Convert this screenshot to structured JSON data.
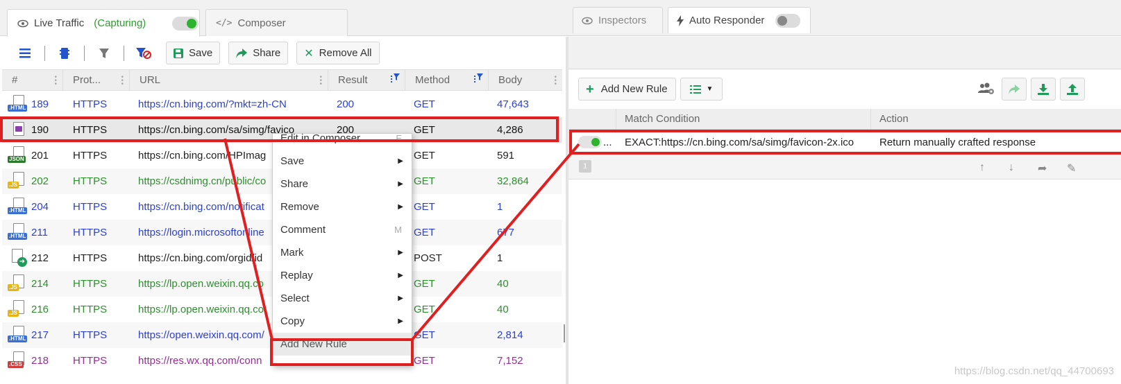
{
  "top_tabs": {
    "live_traffic": {
      "label": "Live Traffic",
      "status": "(Capturing)",
      "toggle": "on"
    },
    "composer": {
      "label": "Composer"
    }
  },
  "toolbar": {
    "save_label": "Save",
    "share_label": "Share",
    "remove_all_label": "Remove All"
  },
  "grid": {
    "headers": [
      "#",
      "Prot...",
      "URL",
      "Result",
      "Method",
      "Body"
    ],
    "rows": [
      {
        "icon": "HTML",
        "num": "189",
        "proto": "HTTPS",
        "url": "https://cn.bing.com/?mkt=zh-CN",
        "result": "200",
        "method": "GET",
        "body": "47,643",
        "color": "blue"
      },
      {
        "icon": "IMG",
        "num": "190",
        "proto": "HTTPS",
        "url": "https://cn.bing.com/sa/simg/favico",
        "result": "200",
        "method": "GET",
        "body": "4,286",
        "color": "black"
      },
      {
        "icon": "JSON",
        "num": "201",
        "proto": "HTTPS",
        "url": "https://cn.bing.com/HPImag",
        "result": "",
        "method": "GET",
        "body": "591",
        "color": "black"
      },
      {
        "icon": "JS",
        "num": "202",
        "proto": "HTTPS",
        "url": "https://csdnimg.cn/public/co",
        "result": "",
        "method": "GET",
        "body": "32,864",
        "color": "green"
      },
      {
        "icon": "HTML",
        "num": "204",
        "proto": "HTTPS",
        "url": "https://cn.bing.com/notificat",
        "result": "",
        "method": "GET",
        "body": "1",
        "color": "blue"
      },
      {
        "icon": "HTML",
        "num": "211",
        "proto": "HTTPS",
        "url": "https://login.microsoftonline",
        "result": "",
        "method": "GET",
        "body": "677",
        "color": "blue"
      },
      {
        "icon": "POST",
        "num": "212",
        "proto": "HTTPS",
        "url": "https://cn.bing.com/orgid/id",
        "result": "",
        "method": "POST",
        "body": "1",
        "color": "black"
      },
      {
        "icon": "JS",
        "num": "214",
        "proto": "HTTPS",
        "url": "https://lp.open.weixin.qq.co",
        "result": "",
        "method": "GET",
        "body": "40",
        "color": "green"
      },
      {
        "icon": "JS",
        "num": "216",
        "proto": "HTTPS",
        "url": "https://lp.open.weixin.qq.co",
        "result": "",
        "method": "GET",
        "body": "40",
        "color": "green"
      },
      {
        "icon": "HTML",
        "num": "217",
        "proto": "HTTPS",
        "url": "https://open.weixin.qq.com/",
        "result": "",
        "method": "GET",
        "body": "2,814",
        "color": "blue"
      },
      {
        "icon": "CSS",
        "num": "218",
        "proto": "HTTPS",
        "url": "https://res.wx.qq.com/conn",
        "result": "",
        "method": "GET",
        "body": "7,152",
        "color": "purple"
      }
    ]
  },
  "context_menu": {
    "items": [
      {
        "label": "Edit in Composer",
        "shortcut": "E",
        "submenu": false
      },
      {
        "label": "Save",
        "shortcut": "",
        "submenu": true
      },
      {
        "label": "Share",
        "shortcut": "",
        "submenu": true
      },
      {
        "label": "Remove",
        "shortcut": "",
        "submenu": true
      },
      {
        "label": "Comment",
        "shortcut": "M",
        "submenu": false
      },
      {
        "label": "Mark",
        "shortcut": "",
        "submenu": true
      },
      {
        "label": "Replay",
        "shortcut": "",
        "submenu": true
      },
      {
        "label": "Select",
        "shortcut": "",
        "submenu": true
      },
      {
        "label": "Copy",
        "shortcut": "",
        "submenu": true
      },
      {
        "label": "Add New Rule",
        "shortcut": "",
        "submenu": false,
        "highlighted": true
      }
    ]
  },
  "right_panel": {
    "tabs": {
      "inspectors": "Inspectors",
      "auto_responder": "Auto Responder",
      "auto_responder_toggle": "off"
    },
    "add_new_rule_label": "Add New Rule",
    "headers": [
      "Match Condition",
      "Action"
    ],
    "rules": [
      {
        "enabled": true,
        "toggle_text": "...",
        "match": "EXACT:https://cn.bing.com/sa/simg/favicon-2x.ico",
        "action": "Return manually crafted response"
      }
    ],
    "rule_count": "1"
  },
  "colors": {
    "accent_green": "#2db32d",
    "annotation_red": "#e02020",
    "link_blue": "#2c3fd1",
    "js_green": "#2c8f2c",
    "css_purple": "#9a2a9a"
  },
  "watermark": "https://blog.csdn.net/qq_44700693"
}
